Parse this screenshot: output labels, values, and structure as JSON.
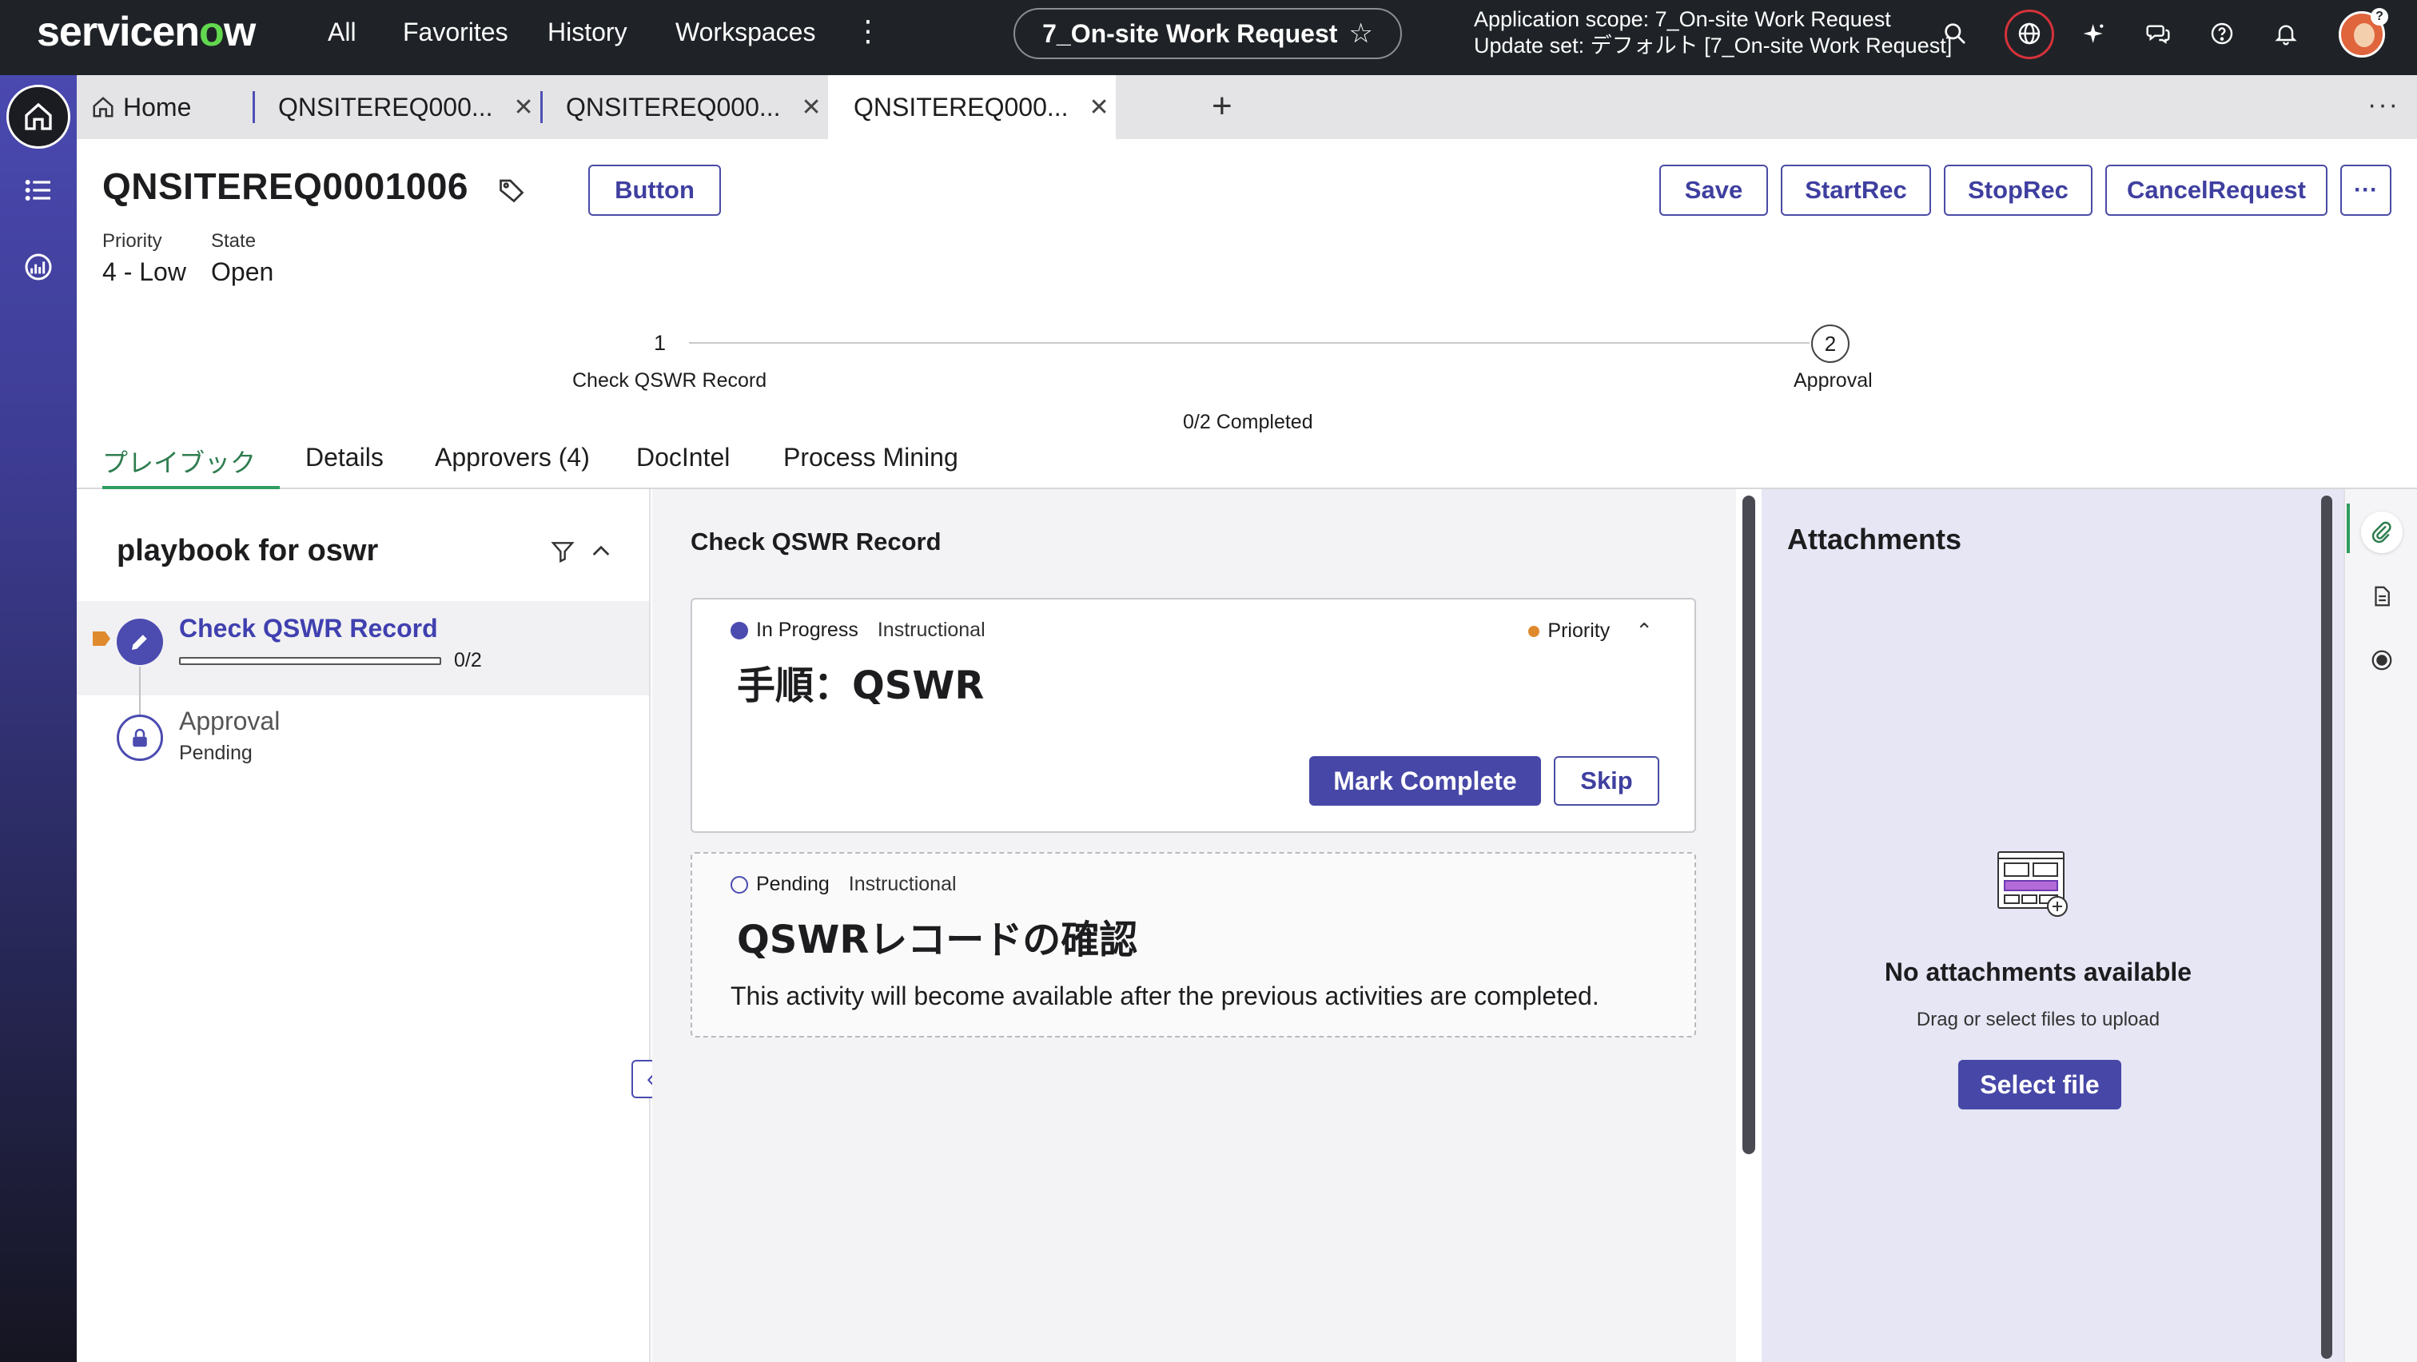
{
  "topbar": {
    "logo_prefix": "servicen",
    "logo_o": "o",
    "logo_suffix": "w",
    "nav": [
      "All",
      "Favorites",
      "History",
      "Workspaces"
    ],
    "scope_pill": "7_On-site Work Request",
    "scope_line1": "Application scope: 7_On-site Work Request",
    "scope_line2": "Update set: デフォルト [7_On-site Work Request]",
    "icons": [
      "search-icon",
      "globe-icon",
      "sparkle-icon",
      "chat-icon",
      "help-icon",
      "bell-icon",
      "avatar"
    ],
    "accent_logo_green": "#62d84e",
    "globe_ring_color": "#d6323a"
  },
  "tabs": {
    "home": "Home",
    "items": [
      "QNSITEREQ000...",
      "QNSITEREQ000...",
      "QNSITEREQ000..."
    ],
    "active_index": 2
  },
  "record": {
    "number": "QNSITEREQ0001006",
    "header_button": "Button",
    "actions": [
      "Save",
      "StartRec",
      "StopRec",
      "CancelRequest"
    ],
    "fields": [
      {
        "label": "Priority",
        "value": "4 - Low"
      },
      {
        "label": "State",
        "value": "Open"
      }
    ]
  },
  "stepper": {
    "step1_num": "1",
    "step1_label": "Check QSWR Record",
    "step2_num": "2",
    "step2_label": "Approval",
    "status": "0/2 Completed"
  },
  "content_tabs": [
    "プレイブック",
    "Details",
    "Approvers (4)",
    "DocIntel",
    "Process Mining"
  ],
  "playbook": {
    "title": "playbook for oswr",
    "items": [
      {
        "title": "Check QSWR Record",
        "progress_text": "0/2",
        "progress": 0.0
      },
      {
        "title": "Approval",
        "sub": "Pending"
      }
    ]
  },
  "activity": {
    "heading": "Check QSWR Record",
    "cards": [
      {
        "status": "In Progress",
        "kind": "Instructional",
        "title": "手順：QSWR",
        "priority": "Priority",
        "primary": "Mark Complete",
        "secondary": "Skip"
      },
      {
        "status": "Pending",
        "kind": "Instructional",
        "title": "QSWRレコードの確認",
        "desc": "This activity will become available after the previous activities are completed."
      }
    ]
  },
  "attachments": {
    "title": "Attachments",
    "empty": "No attachments available",
    "hint": "Drag or select files to upload",
    "button": "Select file"
  },
  "colors": {
    "brand_purple": "#4747a8",
    "active_tab_green": "#2e9d5f",
    "priority_orange": "#e08a2e"
  }
}
